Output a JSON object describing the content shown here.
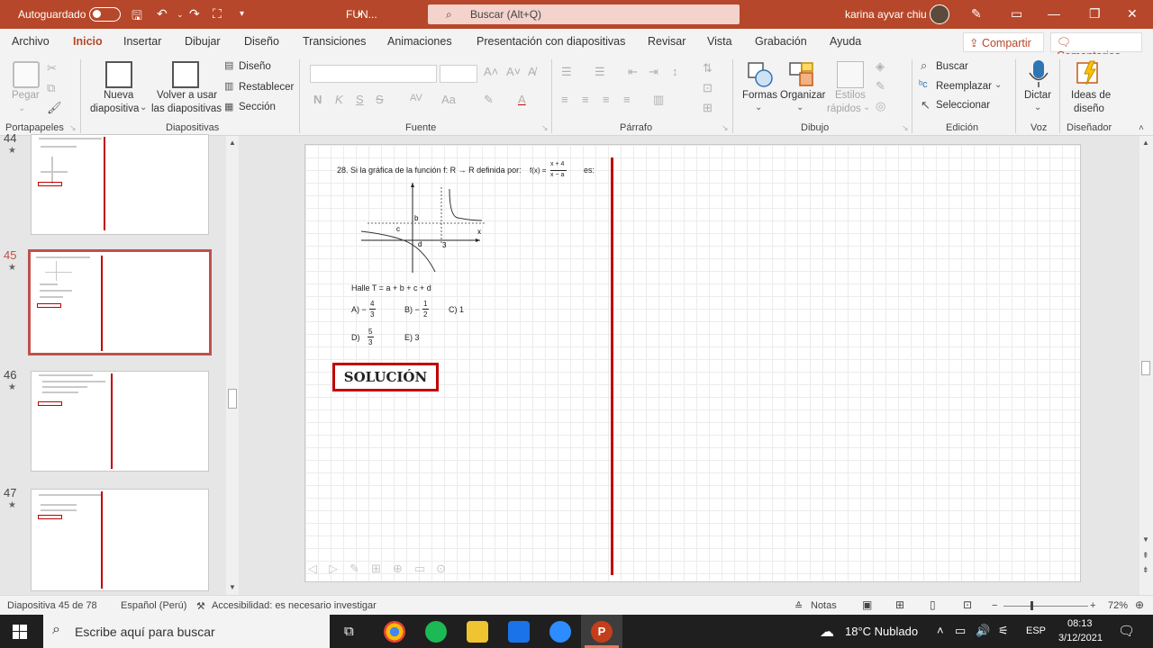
{
  "titlebar": {
    "autosave_label": "Autoguardado",
    "filename": "FUN...",
    "search_text": "Buscar (Alt+Q)",
    "user_name": "karina ayvar chiu"
  },
  "menu": {
    "tabs": [
      "Archivo",
      "Inicio",
      "Insertar",
      "Dibujar",
      "Diseño",
      "Transiciones",
      "Animaciones",
      "Presentación con diapositivas",
      "Revisar",
      "Vista",
      "Grabación",
      "Ayuda"
    ],
    "share": "Compartir",
    "comments": "Comentarios"
  },
  "ribbon": {
    "clipboard": {
      "paste": "Pegar",
      "group": "Portapapeles"
    },
    "slides": {
      "new_slide_1": "Nueva",
      "new_slide_2": "diapositiva",
      "reuse_1": "Volver a usar",
      "reuse_2": "las diapositivas",
      "layout": "Diseño",
      "reset": "Restablecer",
      "section": "Sección",
      "group": "Diapositivas"
    },
    "font": {
      "bold": "N",
      "italic": "K",
      "underline": "S",
      "strike": "S",
      "spacing": "AV",
      "group": "Fuente"
    },
    "paragraph": {
      "group": "Párrafo"
    },
    "drawing": {
      "shapes": "Formas",
      "arrange": "Organizar",
      "styles_1": "Estilos",
      "styles_2": "rápidos",
      "group": "Dibujo"
    },
    "editing": {
      "find": "Buscar",
      "replace": "Reemplazar",
      "select": "Seleccionar",
      "group": "Edición"
    },
    "voice": {
      "dictate": "Dictar",
      "group": "Voz"
    },
    "designer": {
      "ideas_1": "Ideas de",
      "ideas_2": "diseño",
      "group": "Diseñador"
    }
  },
  "thumbnails": [
    {
      "num": "44"
    },
    {
      "num": "45"
    },
    {
      "num": "46"
    },
    {
      "num": "47"
    }
  ],
  "slide": {
    "problem": "28.  Si la gráfica de la función f:  R → R definida por:",
    "func_lhs": "f(x) =",
    "func_num": "x + 4",
    "func_den": "x − a",
    "es": "es:",
    "graph_labels": {
      "b": "b",
      "c": "c",
      "d": "d",
      "three": "3",
      "x": "x"
    },
    "halle": "Halle  T = a + b + c + d",
    "options": {
      "a_pre": "A) −",
      "a_num": "4",
      "a_den": "3",
      "b_pre": "B) −",
      "b_num": "1",
      "b_den": "2",
      "c": "C) 1",
      "d_pre": "D)",
      "d_num": "5",
      "d_den": "3",
      "e": "E) 3"
    },
    "solution": "SOLUCIÓN"
  },
  "status": {
    "slide_info": "Diapositiva 45 de 78",
    "language": "Español (Perú)",
    "accessibility": "Accesibilidad: es necesario investigar",
    "notes": "Notas",
    "zoom": "72%"
  },
  "taskbar": {
    "search": "Escribe aquí para buscar",
    "weather": "18°C  Nublado",
    "lang": "ESP",
    "time": "08:13",
    "date": "3/12/2021"
  }
}
